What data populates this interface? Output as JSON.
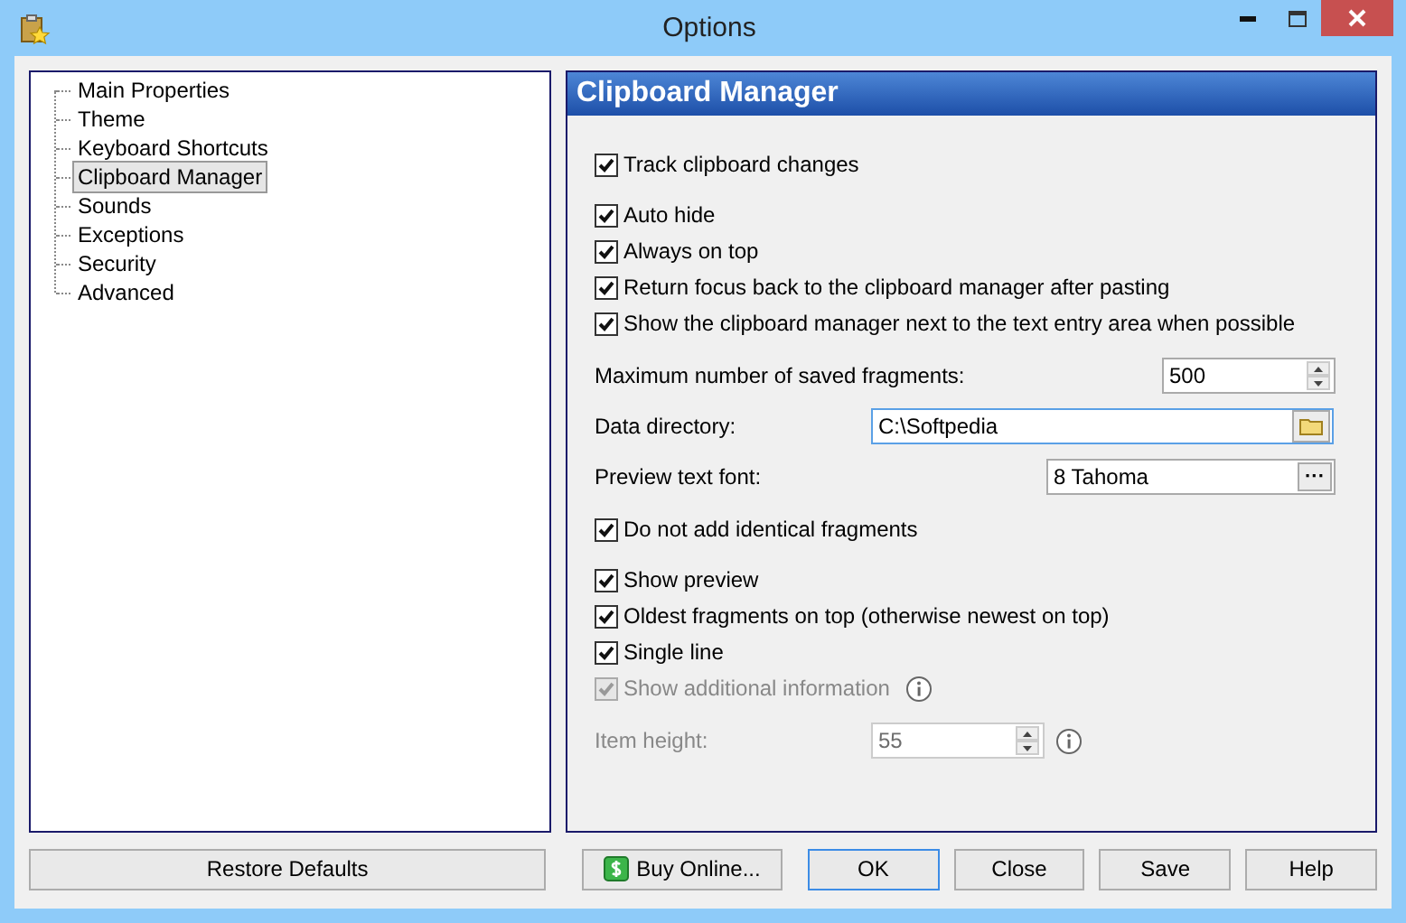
{
  "window": {
    "title": "Options"
  },
  "tree": {
    "items": [
      {
        "label": "Main Properties",
        "selected": false
      },
      {
        "label": "Theme",
        "selected": false
      },
      {
        "label": "Keyboard Shortcuts",
        "selected": false
      },
      {
        "label": "Clipboard Manager",
        "selected": true
      },
      {
        "label": "Sounds",
        "selected": false
      },
      {
        "label": "Exceptions",
        "selected": false
      },
      {
        "label": "Security",
        "selected": false
      },
      {
        "label": "Advanced",
        "selected": false
      }
    ]
  },
  "panel": {
    "title": "Clipboard Manager",
    "groups": [
      {
        "items": [
          {
            "kind": "checkbox",
            "label": "Track clipboard changes",
            "checked": true,
            "disabled": false,
            "info": false
          }
        ]
      },
      {
        "items": [
          {
            "kind": "checkbox",
            "label": "Auto hide",
            "checked": true,
            "disabled": false,
            "info": false
          },
          {
            "kind": "checkbox",
            "label": "Always on top",
            "checked": true,
            "disabled": false,
            "info": false
          },
          {
            "kind": "checkbox",
            "label": "Return focus back to the clipboard manager after pasting",
            "checked": true,
            "disabled": false,
            "info": false
          },
          {
            "kind": "checkbox",
            "label": "Show the clipboard manager next to the text entry area when possible",
            "checked": true,
            "disabled": false,
            "info": false
          }
        ]
      },
      {
        "items": [
          {
            "kind": "spin",
            "label": "Maximum number of saved fragments:",
            "value": "500",
            "disabled": false,
            "focused": false,
            "info": false
          },
          {
            "kind": "folder",
            "label": "Data directory:",
            "value": "C:\\Softpedia",
            "disabled": false,
            "focused": true,
            "info": false
          },
          {
            "kind": "font",
            "label": "Preview text font:",
            "value": "8 Tahoma",
            "button": "···",
            "disabled": false,
            "focused": false,
            "info": false
          }
        ]
      },
      {
        "items": [
          {
            "kind": "checkbox",
            "label": "Do not add identical fragments",
            "checked": true,
            "disabled": false,
            "info": false
          }
        ]
      },
      {
        "items": [
          {
            "kind": "checkbox",
            "label": "Show preview",
            "checked": true,
            "disabled": false,
            "info": false
          },
          {
            "kind": "checkbox",
            "label": "Oldest fragments on top (otherwise newest on top)",
            "checked": true,
            "disabled": false,
            "info": false
          },
          {
            "kind": "checkbox",
            "label": "Single line",
            "checked": true,
            "disabled": false,
            "info": false
          },
          {
            "kind": "checkbox",
            "label": "Show additional information",
            "checked": true,
            "disabled": true,
            "info": true
          }
        ]
      },
      {
        "items": [
          {
            "kind": "short-spin",
            "label": "Item height:",
            "value": "55",
            "disabled": true,
            "focused": false,
            "info": true
          }
        ]
      }
    ]
  },
  "buttons": [
    {
      "label": "Restore Defaults",
      "kind": "wide",
      "default": false
    },
    {
      "label": "Buy Online...",
      "kind": "buy",
      "default": false
    },
    {
      "label": "OK",
      "kind": "plain",
      "default": true
    },
    {
      "label": "Close",
      "kind": "plain",
      "default": false
    },
    {
      "label": "Save",
      "kind": "plain",
      "default": false
    },
    {
      "label": "Help",
      "kind": "plain",
      "default": false
    }
  ]
}
